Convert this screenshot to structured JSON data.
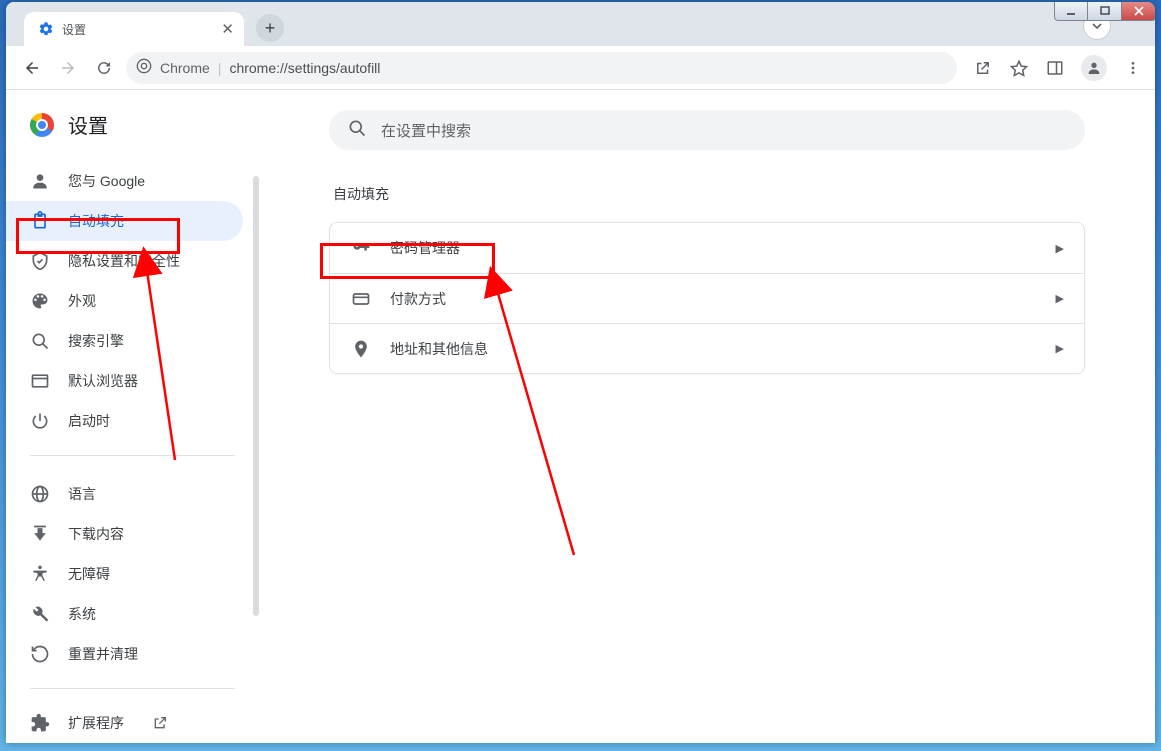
{
  "tab": {
    "title": "设置"
  },
  "omnibox": {
    "scheme_label": "Chrome",
    "url": "chrome://settings/autofill"
  },
  "page": {
    "heading": "设置"
  },
  "search": {
    "placeholder": "在设置中搜索"
  },
  "nav": {
    "items": [
      {
        "label": "您与 Google"
      },
      {
        "label": "自动填充"
      },
      {
        "label": "隐私设置和安全性"
      },
      {
        "label": "外观"
      },
      {
        "label": "搜索引擎"
      },
      {
        "label": "默认浏览器"
      },
      {
        "label": "启动时"
      }
    ],
    "items2": [
      {
        "label": "语言"
      },
      {
        "label": "下载内容"
      },
      {
        "label": "无障碍"
      },
      {
        "label": "系统"
      },
      {
        "label": "重置并清理"
      }
    ],
    "extensions": {
      "label": "扩展程序"
    }
  },
  "section": {
    "heading": "自动填充",
    "rows": [
      {
        "label": "密码管理器"
      },
      {
        "label": "付款方式"
      },
      {
        "label": "地址和其他信息"
      }
    ]
  }
}
